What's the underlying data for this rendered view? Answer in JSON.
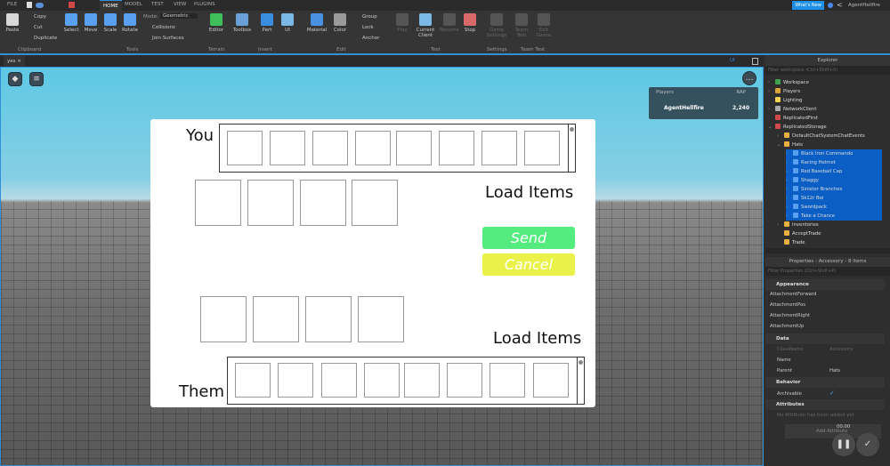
{
  "menubar": {
    "file": "FILE",
    "tabs": [
      {
        "label": "HOME",
        "active": true
      },
      {
        "label": "MODEL"
      },
      {
        "label": "TEST"
      },
      {
        "label": "VIEW"
      },
      {
        "label": "PLUGINS"
      }
    ],
    "whats_new": "What's New",
    "user": "AgentHellfire"
  },
  "ribbon": {
    "buttons": [
      {
        "label": "Paste",
        "icon": "paste-icon",
        "color": "#d8d8d8"
      },
      {
        "label": "Select",
        "icon": "cursor-icon",
        "color": "#5aa0f0"
      },
      {
        "label": "Move",
        "icon": "move-icon",
        "color": "#5aa0f0"
      },
      {
        "label": "Scale",
        "icon": "scale-icon",
        "color": "#5aa0f0"
      },
      {
        "label": "Rotate",
        "icon": "rotate-icon",
        "color": "#5aa0f0"
      },
      {
        "label": "Editor",
        "icon": "terrain-icon",
        "color": "#3fbf5a"
      },
      {
        "label": "Toolbox",
        "icon": "toolbox-icon",
        "color": "#6aa0d8"
      },
      {
        "label": "Part",
        "icon": "part-icon",
        "color": "#3a8ee0"
      },
      {
        "label": "UI",
        "icon": "ui-icon",
        "color": "#7ab8e8"
      },
      {
        "label": "Material",
        "icon": "material-icon",
        "color": "#4a90e0"
      },
      {
        "label": "Color",
        "icon": "color-icon",
        "color": "#9a9a9a"
      },
      {
        "label": "Play",
        "icon": "play-icon",
        "color": "#555",
        "dim": true
      },
      {
        "label": "Current Client",
        "icon": "client-icon",
        "color": "#7ab8e8"
      },
      {
        "label": "Resume",
        "icon": "resume-icon",
        "color": "#555",
        "dim": true
      },
      {
        "label": "Stop",
        "icon": "stop-icon",
        "color": "#d96a6a"
      },
      {
        "label": "Game Settings",
        "icon": "gear-icon",
        "color": "#555",
        "dim": true
      },
      {
        "label": "Team Test",
        "icon": "team-icon",
        "color": "#555",
        "dim": true
      },
      {
        "label": "Exit Game",
        "icon": "exit-icon",
        "color": "#555",
        "dim": true
      }
    ],
    "clipboard_small": [
      "Copy",
      "Cut",
      "Duplicate"
    ],
    "mode_label": "Mode:",
    "mode_value": "Geometric",
    "collisions": "Collisions",
    "join_surfaces": "Join Surfaces",
    "edit_small": [
      "Group",
      "Lock",
      "Anchor"
    ],
    "groups": [
      "Clipboard",
      "Tools",
      "Terrain",
      "Insert",
      "Edit",
      "Test",
      "Settings",
      "Team Test"
    ]
  },
  "tab": {
    "name": "yes"
  },
  "viewport": {
    "ui_toggle": "UI",
    "leaderboard": {
      "col1": "Players",
      "col2": "RAP",
      "player": "AgentHellfire",
      "rap": "2,240"
    }
  },
  "trade": {
    "you": "You",
    "them": "Them",
    "load_items": "Load Items",
    "load_items_2": "Load Items",
    "send": "Send",
    "cancel": "Cancel",
    "send_color": "#55ec7f",
    "cancel_color": "#eaf24a"
  },
  "explorer": {
    "title": "Explorer",
    "filter": "Filter workspace (Ctrl+Shift+X)",
    "items": [
      {
        "label": "Workspace",
        "depth": 0,
        "arrow": ">",
        "color": "#3fa34d"
      },
      {
        "label": "Players",
        "depth": 0,
        "arrow": ">",
        "color": "#d9a33a"
      },
      {
        "label": "Lighting",
        "depth": 0,
        "arrow": "",
        "color": "#f2d24a"
      },
      {
        "label": "NetworkClient",
        "depth": 0,
        "arrow": ">",
        "color": "#aaa"
      },
      {
        "label": "ReplicatedFirst",
        "depth": 0,
        "arrow": "",
        "color": "#d04848"
      },
      {
        "label": "ReplicatedStorage",
        "depth": 0,
        "arrow": "v",
        "color": "#d04848"
      },
      {
        "label": "DefaultChatSystemChatEvents",
        "depth": 1,
        "arrow": ">",
        "color": "#e8b040"
      },
      {
        "label": "Hats",
        "depth": 1,
        "arrow": "v",
        "color": "#e8b040"
      },
      {
        "label": "Black Iron Commando",
        "depth": 2,
        "arrow": ">",
        "color": "#5aa0f0",
        "selected": true
      },
      {
        "label": "Racing Helmet",
        "depth": 2,
        "arrow": ">",
        "color": "#5aa0f0",
        "selected": true
      },
      {
        "label": "Red Baseball Cap",
        "depth": 2,
        "arrow": ">",
        "color": "#5aa0f0",
        "selected": true
      },
      {
        "label": "Shaggy",
        "depth": 2,
        "arrow": ">",
        "color": "#5aa0f0",
        "selected": true
      },
      {
        "label": "Sinister Branches",
        "depth": 2,
        "arrow": ">",
        "color": "#5aa0f0",
        "selected": true
      },
      {
        "label": "Sk12r Boi",
        "depth": 2,
        "arrow": ">",
        "color": "#5aa0f0",
        "selected": true
      },
      {
        "label": "Swordpack",
        "depth": 2,
        "arrow": ">",
        "color": "#5aa0f0",
        "selected": true
      },
      {
        "label": "Take a Chance",
        "depth": 2,
        "arrow": ">",
        "color": "#5aa0f0",
        "selected": true
      },
      {
        "label": "Inventories",
        "depth": 1,
        "arrow": ">",
        "color": "#e8b040"
      },
      {
        "label": "AcceptTrade",
        "depth": 1,
        "arrow": "",
        "color": "#e8b040"
      },
      {
        "label": "Trade",
        "depth": 1,
        "arrow": "",
        "color": "#e8b040"
      }
    ]
  },
  "properties": {
    "title": "Properties - Accessory - 8 items",
    "filter": "Filter Properties (Ctrl+Shift+P)",
    "appearance": "Appearance",
    "appearance_items": [
      "AttachmentForward",
      "AttachmentPos",
      "AttachmentRight",
      "AttachmentUp"
    ],
    "data": "Data",
    "classname": "ClassName",
    "classname_value": "Accessory",
    "name": "Name",
    "parent": "Parent",
    "parent_value": "Hats",
    "behavior": "Behavior",
    "archivable": "Archivable",
    "archivable_checked": true,
    "attributes": "Attributes",
    "no_attributes": "No Attribute has been added yet",
    "add_attribute": "Add Attribute"
  },
  "recorder": {
    "time": "00:00"
  }
}
